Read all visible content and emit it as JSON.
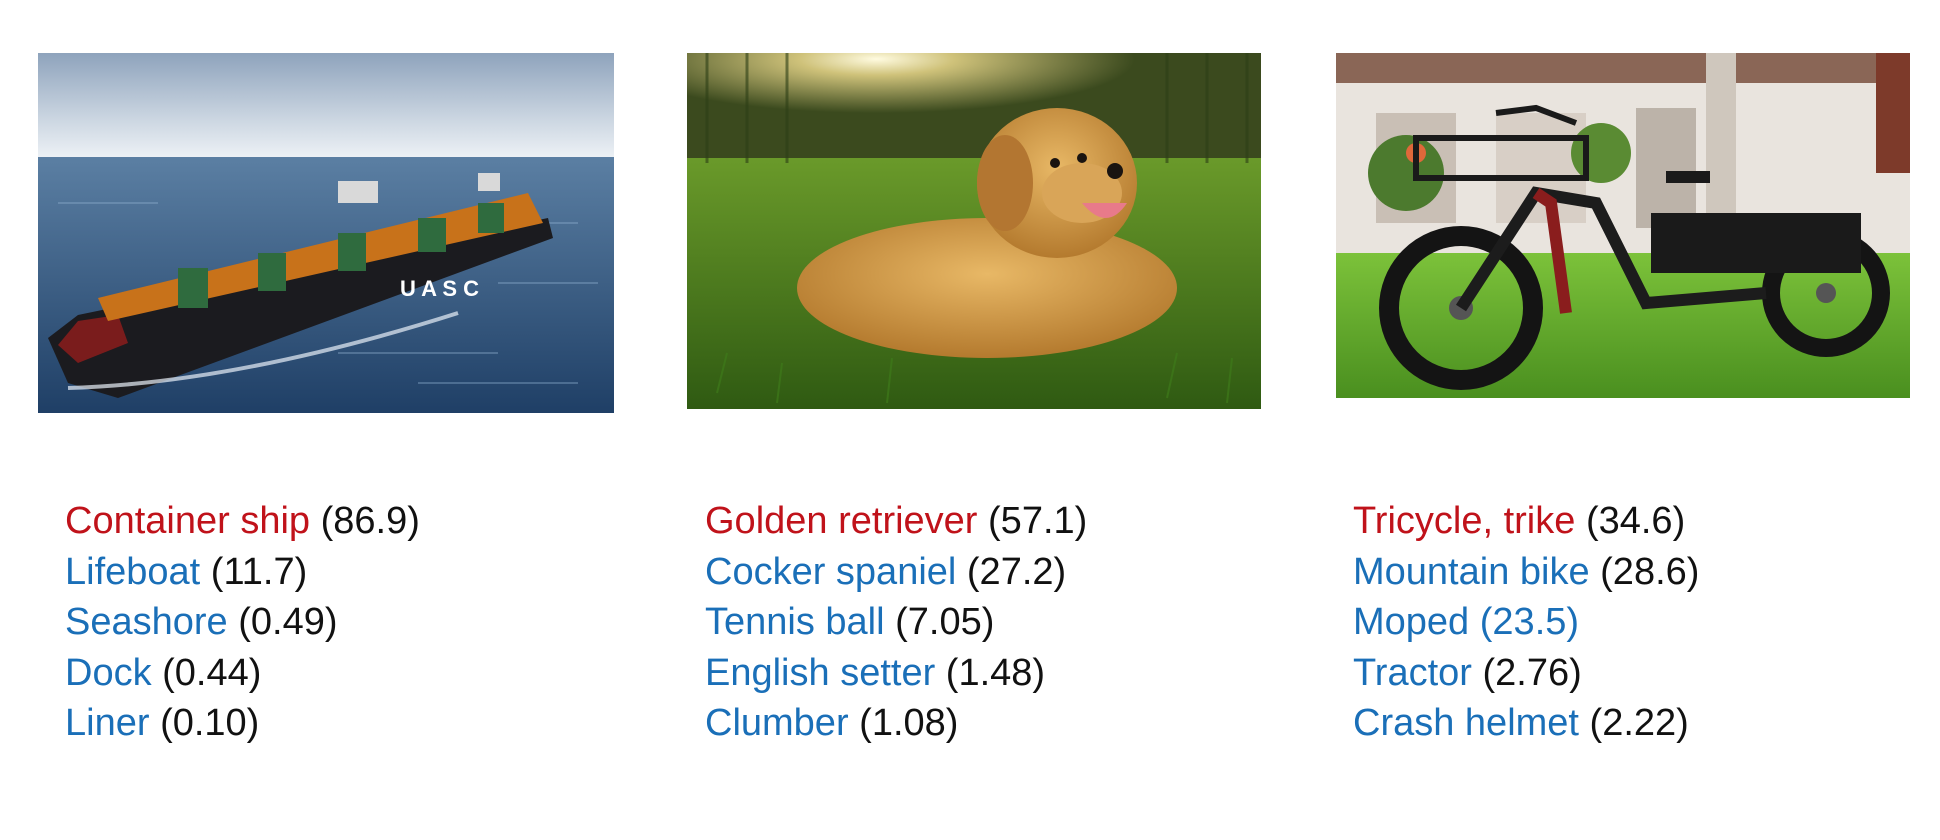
{
  "colors": {
    "top_label": "#c0121a",
    "other_label": "#1a6fb8",
    "score": "#111111"
  },
  "panels": [
    {
      "image": "container-ship-photo",
      "predictions": [
        {
          "label": "Container ship",
          "score": "(86.9)",
          "top": true
        },
        {
          "label": "Lifeboat",
          "score": "(11.7)"
        },
        {
          "label": "Seashore",
          "score": "(0.49)"
        },
        {
          "label": "Dock",
          "score": "(0.44)"
        },
        {
          "label": "Liner",
          "score": "(0.10)"
        }
      ]
    },
    {
      "image": "golden-retriever-photo",
      "predictions": [
        {
          "label": "Golden retriever",
          "score": "(57.1)",
          "top": true
        },
        {
          "label": "Cocker spaniel",
          "score": "(27.2)"
        },
        {
          "label": "Tennis ball",
          "score": "(7.05)"
        },
        {
          "label": "English setter",
          "score": "(1.48)"
        },
        {
          "label": "Clumber",
          "score": "(1.08)"
        }
      ]
    },
    {
      "image": "electric-tricycle-photo",
      "predictions": [
        {
          "label": "Tricycle, trike",
          "score": "(34.6)",
          "top": true
        },
        {
          "label": "Mountain bike",
          "score": "(28.6)"
        },
        {
          "label": "Moped",
          "score": "(23.5)",
          "score_blue": true
        },
        {
          "label": "Tractor",
          "score": "(2.76)"
        },
        {
          "label": "Crash helmet",
          "score": "(2.22)"
        }
      ]
    }
  ]
}
